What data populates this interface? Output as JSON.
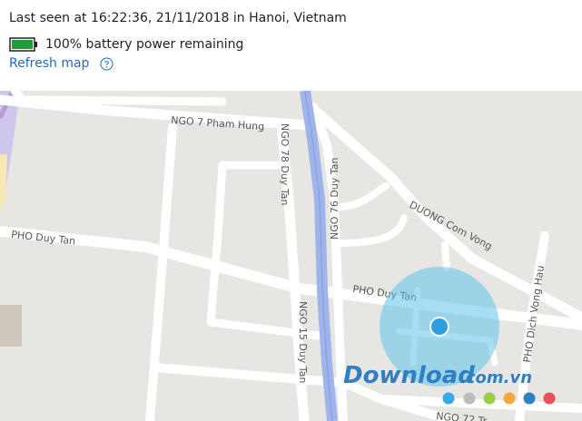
{
  "status": {
    "last_seen": "Last seen at 16:22:36, 21/11/2018 in Hanoi, Vietnam",
    "battery_text": "100% battery power remaining",
    "battery_level": 1.0,
    "battery_color": "#1e9d3a"
  },
  "actions": {
    "refresh_label": "Refresh map",
    "help_icon": "question-circle-icon"
  },
  "map": {
    "streets": {
      "ngo7": "NGO 7 Pham Hung",
      "ngo78": "NGO 78 Duy Tan",
      "ngo76": "NGO 76 Duy Tan",
      "duong_com_vong": "DUONG Com Vong",
      "pho_duy_tan_left": "PHO Duy Tan",
      "pho_duy_tan_right": "PHO Duy Tan",
      "ngo15": "NGO 15 Duy Tan",
      "pho_dich_vong_hau": "PHO Dich Vong Hau",
      "ngo72": "NGO 72 Tr..."
    },
    "colors": {
      "land": "#e8e6e2",
      "road": "#ffffff",
      "rail": "#9fb4ea",
      "location_circle": "#5cc3ea",
      "location_dot": "#2b9fe0"
    },
    "watermark": {
      "brand": "Download",
      "suffix": ".com.vn",
      "dot_colors": [
        "#3aa8e2",
        "#bdbdbd",
        "#9ccd49",
        "#f0a93a",
        "#2e7fc4",
        "#e8505b"
      ]
    }
  }
}
